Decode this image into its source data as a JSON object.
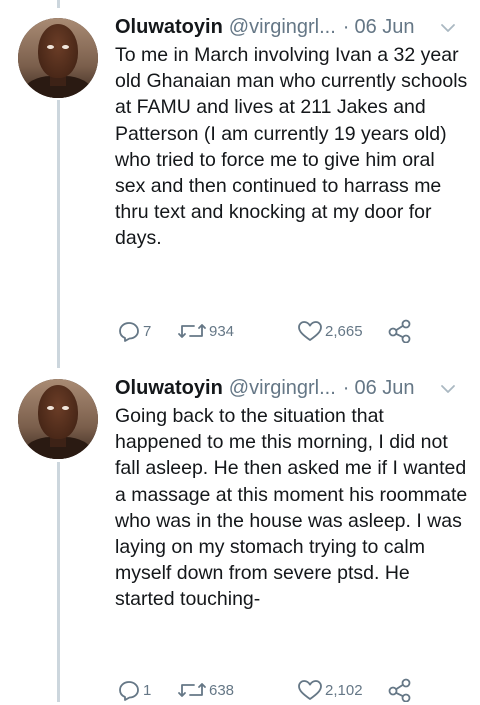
{
  "tweets": [
    {
      "display_name": "Oluwatoyin",
      "handle": "@virgingrl...",
      "separator": "·",
      "date": "06 Jun",
      "text": "To me in March involving Ivan a 32 year old Ghanaian man who currently schools at FAMU and lives at 211 Jakes and Patterson (I am currently 19 years old) who tried to force me to give him oral sex and then continued to harrass me thru text and knocking at my door for days.",
      "replies": "7",
      "retweets": "934",
      "likes": "2,665",
      "icons": [
        "reply-icon",
        "retweet-icon",
        "like-icon",
        "share-icon"
      ]
    },
    {
      "display_name": "Oluwatoyin",
      "handle": "@virgingrl...",
      "separator": "·",
      "date": "06 Jun",
      "text": "Going back to the situation that happened to me this morning, I did not fall asleep. He then asked me if I wanted a massage at this moment his roommate who was in the house was asleep. I was laying on my stomach trying to calm myself down from severe ptsd. He started touching-",
      "replies": "1",
      "retweets": "638",
      "likes": "2,102",
      "icons": [
        "reply-icon",
        "retweet-icon",
        "like-icon",
        "share-icon"
      ]
    }
  ],
  "colors": {
    "text": "#14171a",
    "secondary": "#657786",
    "thread_line": "#ccd6dd"
  }
}
